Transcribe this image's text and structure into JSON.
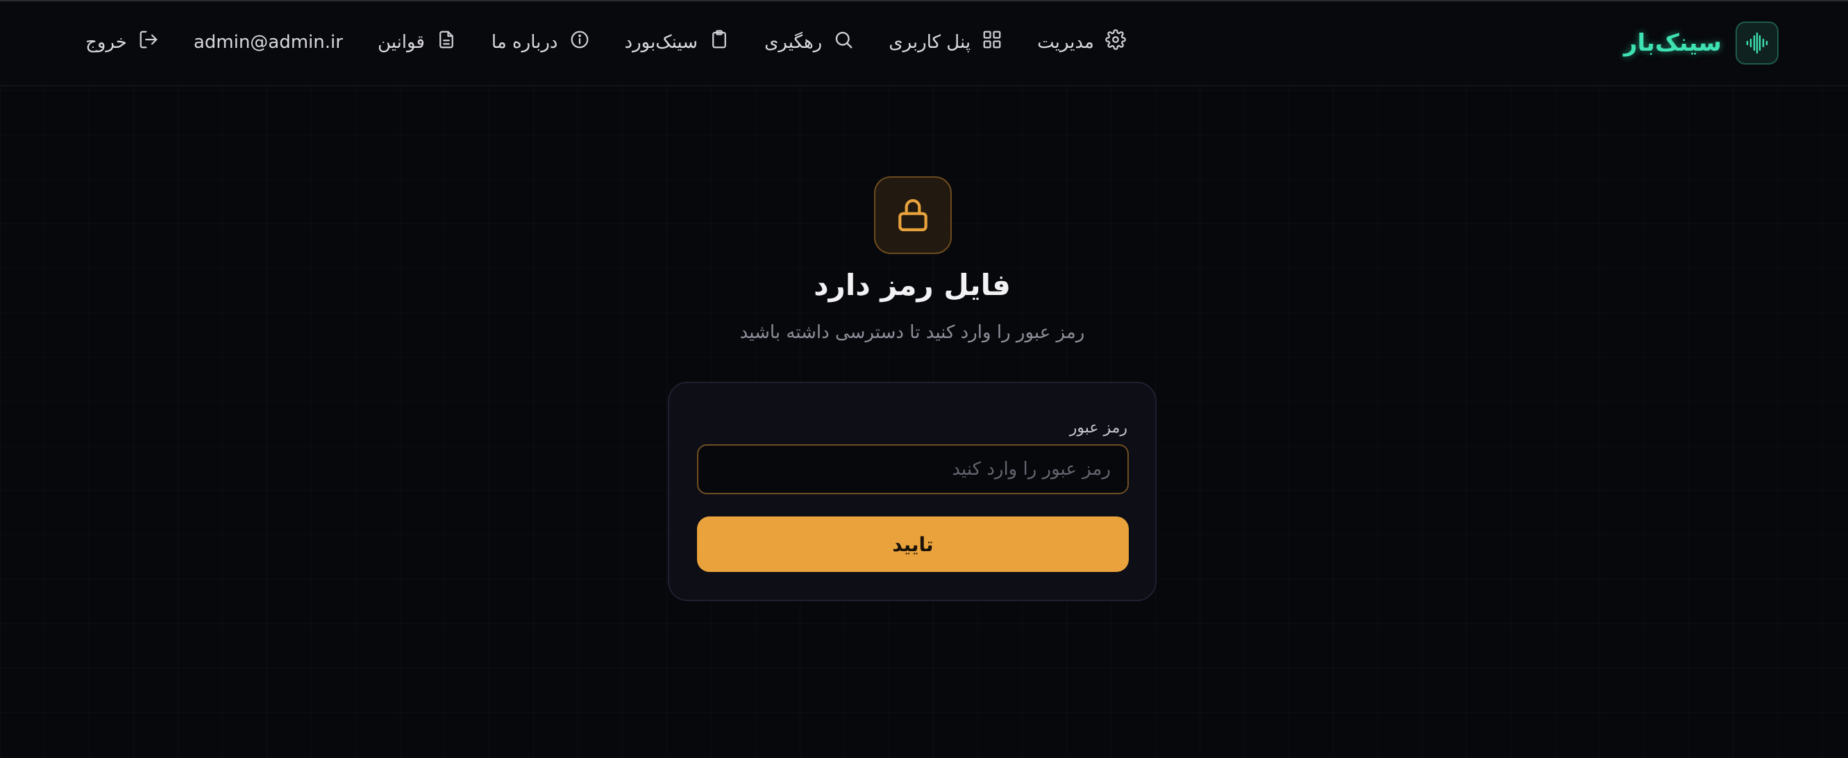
{
  "brand": {
    "name": "سینک‌بار",
    "logo_icon": "waveform-icon",
    "accent_color": "#3ee2b3"
  },
  "nav": {
    "items": [
      {
        "label": "مدیریت",
        "icon": "gear-icon"
      },
      {
        "label": "پنل کاربری",
        "icon": "grid-icon"
      },
      {
        "label": "رهگیری",
        "icon": "search-icon"
      },
      {
        "label": "سینک‌بورد",
        "icon": "clipboard-icon"
      },
      {
        "label": "درباره ما",
        "icon": "info-icon"
      },
      {
        "label": "قوانین",
        "icon": "document-icon"
      }
    ],
    "user_email": "admin@admin.ir",
    "logout": {
      "label": "خروج",
      "icon": "logout-icon"
    }
  },
  "main": {
    "lock_icon": "lock-icon",
    "title": "فایل رمز دارد",
    "subtitle": "رمز عبور را وارد کنید تا دسترسی داشته باشید",
    "form": {
      "password_label": "رمز عبور",
      "password_value": "",
      "password_placeholder": "رمز عبور را وارد کنید",
      "submit_label": "تایید"
    },
    "accent_color": "#e9a23c"
  }
}
